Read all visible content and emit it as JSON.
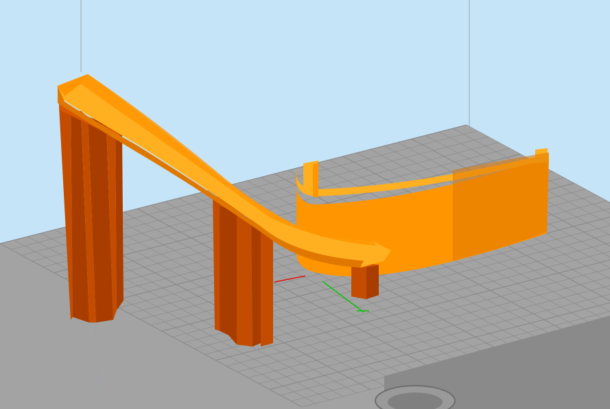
{
  "viewport": {
    "background_color": "#c6e4f8",
    "bed_color": "#a3a3a3",
    "bed_grid_color": "#8b8b8b",
    "bed_side_color": "#8a8a8a",
    "vertical_line_color": "#9aa4ab",
    "icons": [
      "bed-grid",
      "axis-gizmo",
      "model-object"
    ]
  },
  "scene": {
    "model_colors": {
      "top": "#ffb020",
      "front": "#ff9500",
      "side": "#e07800",
      "support_front": "#c44c00",
      "support_side": "#a93d00",
      "support_top": "#d65800"
    },
    "axes": [
      {
        "name": "x",
        "color": "#e01010"
      },
      {
        "name": "y",
        "color": "#10c010"
      },
      {
        "name": "z",
        "color": "#1020e0"
      }
    ],
    "objects": [
      "arched-support-left",
      "ramp-track",
      "support-pillar-middle",
      "curved-wall",
      "support-block-right",
      "bed-base"
    ]
  }
}
